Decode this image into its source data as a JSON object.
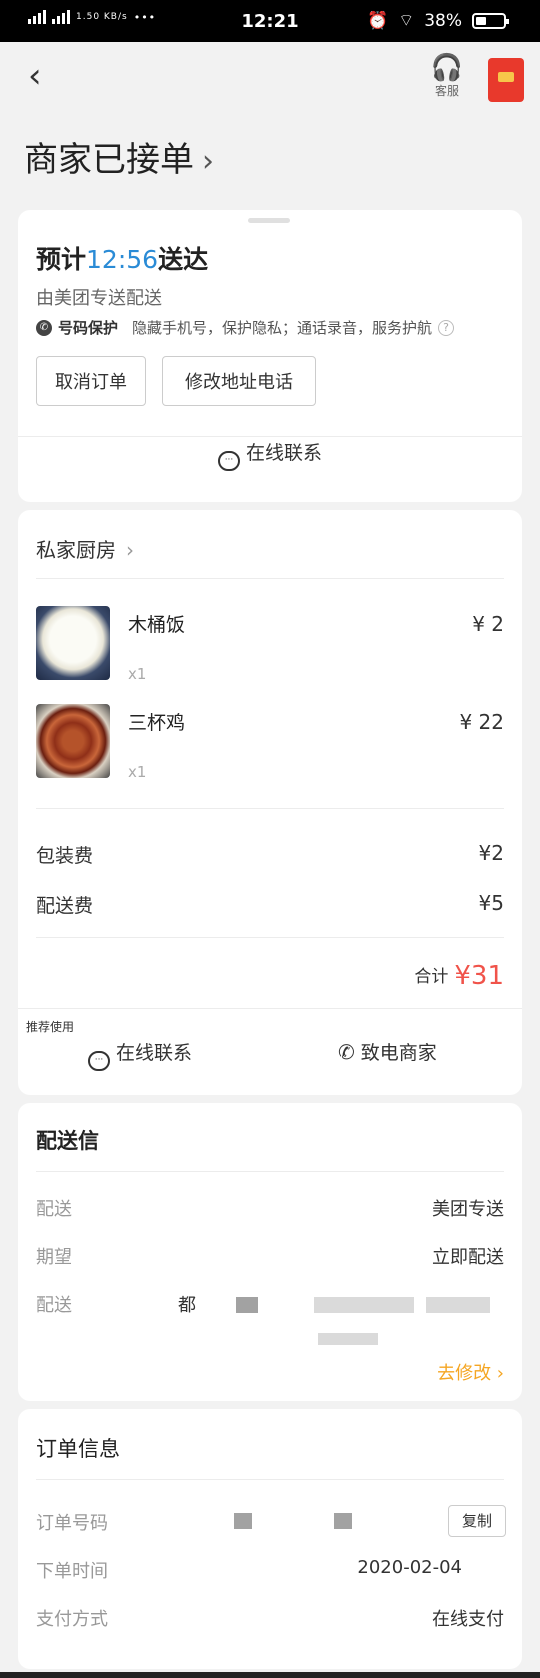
{
  "status_bar": {
    "net1": "4G HD",
    "net2": "4G HD",
    "speed": "1.50 KB/s",
    "dots": "•••",
    "time": "12:21",
    "alarm": "⏰",
    "wifi": "⌔",
    "battery": "38%"
  },
  "nav": {
    "back": "‹",
    "service_label": "客服",
    "service_icon": "🎧"
  },
  "order_status": {
    "title": "商家已接单",
    "chevron": "›"
  },
  "delivery_card": {
    "eta_prefix": "预计",
    "eta_time": "12:56",
    "eta_suffix": "送达",
    "rider": "由美团专送配送",
    "protect_icon": "📞",
    "protect_tag": "号码保护",
    "protect_text": "隐藏手机号，保护隐私；通话录音，服务护航",
    "help": "?",
    "cancel_label": "取消订单",
    "modify_label": "修改地址电话",
    "contact_icon": "···",
    "contact_label": "在线联系"
  },
  "order_card": {
    "shop_name": "私家厨房",
    "chevron": "›",
    "items": [
      {
        "name": "木桶饭",
        "qty": "x1",
        "price": "¥ 2"
      },
      {
        "name": "三杯鸡",
        "qty": "x1",
        "price": "¥ 22"
      }
    ],
    "fees": [
      {
        "label": "包装费",
        "value": "¥2"
      },
      {
        "label": "配送费",
        "value": "¥5"
      }
    ],
    "total_label": "合计",
    "total_value": "¥31",
    "recommend": "推荐使用",
    "contact_icon": "···",
    "contact_label": "在线联系",
    "call_icon": "✆",
    "call_label": "致电商家"
  },
  "delivery_info": {
    "title": "配送信",
    "rows": [
      {
        "label": "配送",
        "value": "美团专送"
      },
      {
        "label": "期望",
        "value": "立即配送"
      },
      {
        "label": "配送",
        "value": "都"
      }
    ],
    "edit_label": "去修改 ›"
  },
  "order_info": {
    "title": "订单信息",
    "rows": [
      {
        "label": "订单号码",
        "value": ""
      },
      {
        "label": "下单时间",
        "value": "2020-02-04"
      },
      {
        "label": "支付方式",
        "value": "在线支付"
      }
    ],
    "copy_label": "复制"
  },
  "colors": {
    "accent_blue": "#2a8bd6",
    "price_red": "#f0534a",
    "link_orange": "#f5a623"
  }
}
